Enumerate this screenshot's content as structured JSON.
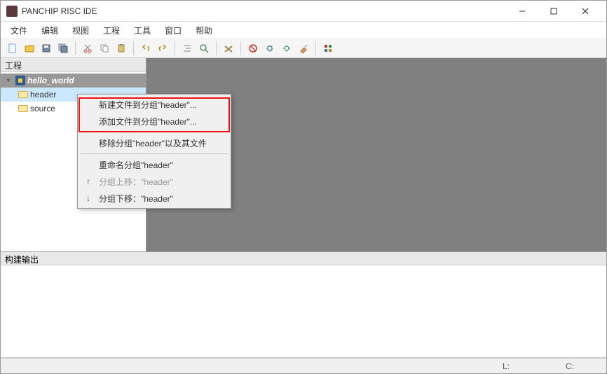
{
  "window": {
    "title": "PANCHIP RISC IDE"
  },
  "menubar": [
    "文件",
    "编辑",
    "视图",
    "工程",
    "工具",
    "窗口",
    "帮助"
  ],
  "sidebar": {
    "title": "工程",
    "project": "hello_world",
    "items": [
      {
        "label": "header"
      },
      {
        "label": "source"
      }
    ]
  },
  "context_menu": {
    "new_file": "新建文件到分组\"header\"...",
    "add_file": "添加文件到分组\"header\"...",
    "remove_group": "移除分组\"header\"以及其文件",
    "rename_group": "重命名分组\"header\"",
    "move_up": "分组上移：\"header\"",
    "move_down": "分组下移：\"header\""
  },
  "output": {
    "title": "构建输出"
  },
  "statusbar": {
    "line": "L:",
    "col": "C:"
  }
}
